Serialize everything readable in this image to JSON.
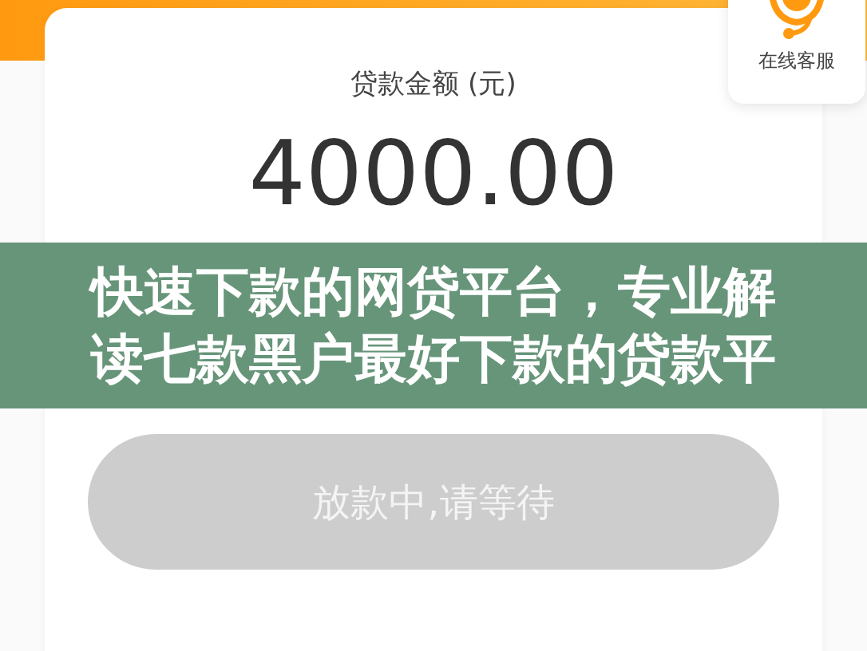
{
  "support_widget": {
    "label": "在线客服"
  },
  "loan_card": {
    "amount_label": "贷款金额 (元)",
    "amount": "4000.00"
  },
  "submit_button": {
    "label": "放款中,请等待",
    "disabled": true
  },
  "caption_banner": {
    "lines": [
      "快速下款的网贷平台，专业解",
      "读七款黑户最好下款的贷款平"
    ]
  }
}
